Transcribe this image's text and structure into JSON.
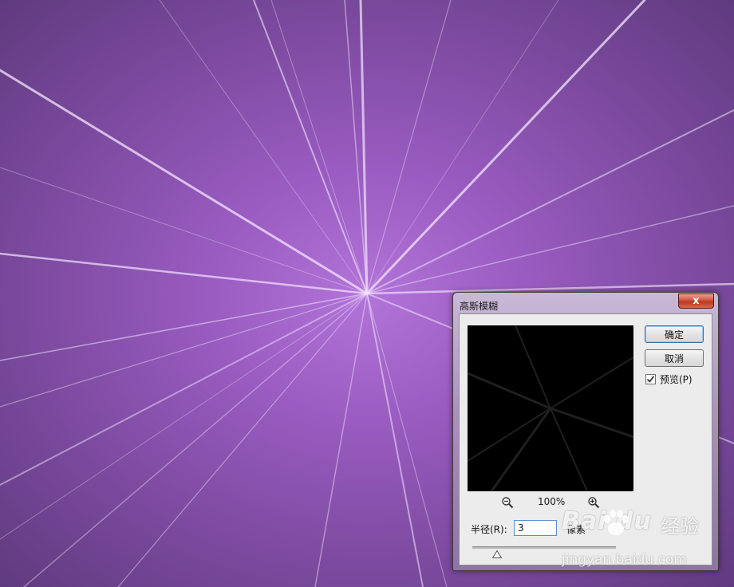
{
  "dialog": {
    "title": "高斯模糊",
    "close_label": "x",
    "ok_label": "确定",
    "cancel_label": "取消",
    "preview_label": "预览(P)",
    "preview_checked": true,
    "zoom_level": "100%",
    "radius_label": "半径(R):",
    "radius_value": "3",
    "unit_label": "像素",
    "slider_fraction": 0.17
  },
  "watermark": {
    "logo": "Bai du",
    "brand": "经验",
    "url": "jingyan.baidu.com"
  },
  "colors": {
    "background_center": "#b274d8",
    "background_edge": "#5f3a7e",
    "dialog_frame": "#a990bd",
    "close_red": "#c8432b"
  },
  "icons": [
    "close-icon",
    "zoom-out-icon",
    "zoom-in-icon",
    "check-icon",
    "slider-thumb-icon",
    "paw-icon"
  ]
}
